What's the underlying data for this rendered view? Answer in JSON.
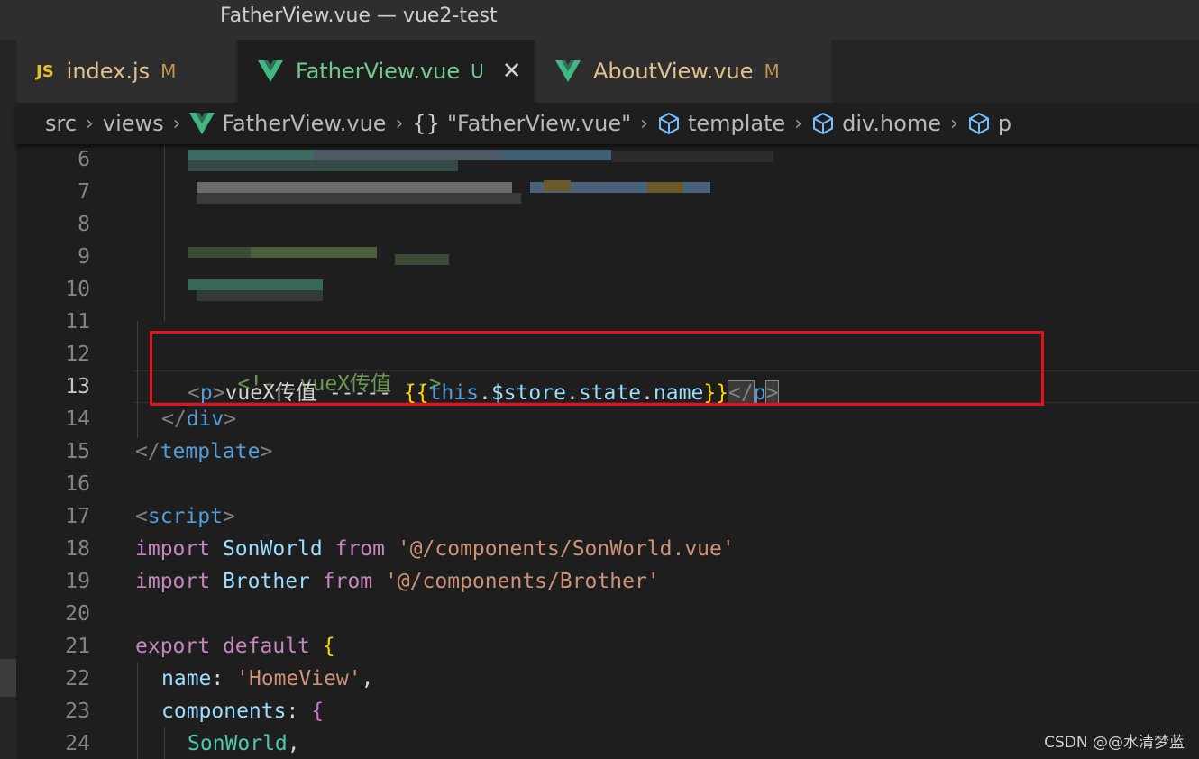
{
  "window": {
    "title": "FatherView.vue — vue2-test"
  },
  "tabs": [
    {
      "icon": "JS",
      "label": "index.js",
      "status": "M",
      "status_color": "#c09553",
      "label_color": "#e2c08d"
    },
    {
      "icon": "vue-icon",
      "label": "FatherView.vue",
      "status": "U",
      "status_color": "#73c991",
      "label_color": "#73c991",
      "close": "✕"
    },
    {
      "icon": "vue-icon",
      "label": "AboutView.vue",
      "status": "M",
      "status_color": "#c09553",
      "label_color": "#e2c08d"
    }
  ],
  "breadcrumb": {
    "items": [
      "src",
      "views",
      "FatherView.vue",
      "\"FatherView.vue\"",
      "template",
      "div.home",
      "p"
    ],
    "object_icon": "{}",
    "separator": "›"
  },
  "line_numbers": [
    "6",
    "7",
    "8",
    "9",
    "10",
    "11",
    "12",
    "13",
    "14",
    "15",
    "16",
    "17",
    "18",
    "19",
    "20",
    "21",
    "22",
    "23",
    "24"
  ],
  "current_line": "13",
  "code": {
    "l12": "<!-- vueX传值 -->",
    "l13": {
      "open_lt": "<",
      "open_tag": "p",
      "open_gt": ">",
      "text": "vueX传值 ----- ",
      "brace_open": "{{",
      "this_kw": "this",
      "dot1": ".",
      "store": "$store",
      "dot2": ".",
      "state": "state",
      "dot3": ".",
      "name": "name",
      "brace_close": "}}",
      "close_lt": "</",
      "close_tag": "p",
      "close_gt": ">"
    },
    "l14": {
      "lt": "</",
      "tag": "div",
      "gt": ">"
    },
    "l15": {
      "lt": "</",
      "tag": "template",
      "gt": ">"
    },
    "l17": {
      "lt": "<",
      "tag": "script",
      "gt": ">"
    },
    "l18": {
      "kw": "import",
      "name": "SonWorld",
      "from": "from",
      "path": "'@/components/SonWorld.vue'"
    },
    "l19": {
      "kw": "import",
      "name": "Brother",
      "from": "from",
      "path": "'@/components/Brother'"
    },
    "l21": {
      "kw1": "export",
      "kw2": "default",
      "brace": "{"
    },
    "l22": {
      "key": "name",
      "colon": ": ",
      "value": "'HomeView'",
      "comma": ","
    },
    "l23": {
      "key": "components",
      "colon": ": ",
      "brace": "{"
    },
    "l24": {
      "name": "SonWorld",
      "comma": ","
    }
  },
  "watermark": "CSDN @@水清梦蓝",
  "colors": {
    "highlight_box": "#e4101a",
    "vue_logo": "#41b883",
    "js_badge": "#e5c02a"
  }
}
